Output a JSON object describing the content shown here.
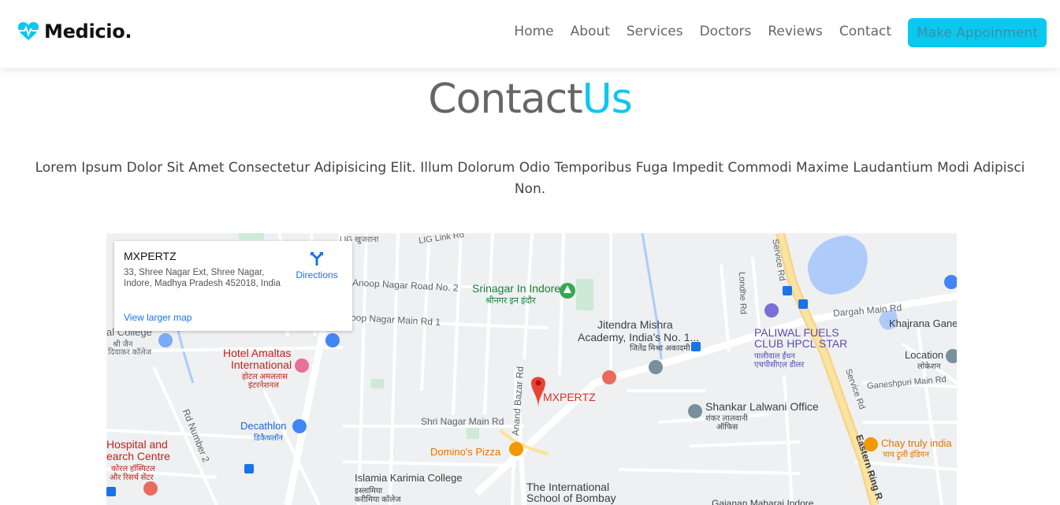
{
  "header": {
    "brand": "Medicio.",
    "nav": [
      "Home",
      "About",
      "Services",
      "Doctors",
      "Reviews",
      "Contact"
    ],
    "cta": "Make Appoinment",
    "accent_color": "#0ac8ef"
  },
  "section": {
    "title_main": "Contact",
    "title_accent": "Us",
    "description": "Lorem Ipsum Dolor Sit Amet Consectetur Adipisicing Elit. Illum Dolorum Odio Temporibus Fuga Impedit Commodi Maxime Laudantium Modi Adipisci Non."
  },
  "map": {
    "card": {
      "name": "MXPERTZ",
      "address": "33, Shree Nagar Ext, Shree Nagar, Indore, Madhya Pradesh 452018, India",
      "directions": "Directions",
      "larger_map": "View larger map"
    },
    "marker": "MXPERTZ",
    "labels": {
      "lig": "LIG खुजराना",
      "lig_link": "LIG Link Rd",
      "anoop2": "Anoop Nagar Road No. 2",
      "anoop_main": "oop Nagar Main Rd 1",
      "srinagar": "Srinagar In Indore",
      "srinagar_hi": "श्रीनगर इन इंदौर",
      "jitendra1": "Jitendra Mishra",
      "jitendra2": "Academy, India's No. 1...",
      "jitendra_hi": "जितेंद्र मिश्रा अकादमी",
      "college1": "al College",
      "college_hi1": "श्री जैन",
      "college_hi2": "दिवाकर कॉलेज",
      "hotel1": "Hotel Amaltas",
      "hotel2": "International",
      "hotel_hi1": "होटल अमलतास",
      "hotel_hi2": "इंटरनेशनल",
      "decathlon": "Decathlon",
      "decathlon_hi": "डिकैथलॉन",
      "hospital1": "Hospital and",
      "hospital2": "earch Centre",
      "hospital_hi1": "कोरल हॉस्पिटल",
      "hospital_hi2": "और रिसर्च सेंटर",
      "rd_number2": "Rd Number 2",
      "shri_nagar_main": "Shri Nagar Main Rd",
      "anand_bazar": "Anand Bazar Rd",
      "dominos": "Domino's Pizza",
      "islamia": "Islamia Karimia College",
      "islamia_hi1": "इस्लामिया",
      "islamia_hi2": "करीमिया कॉलेज",
      "intl_school1": "The International",
      "intl_school2": "School of Bombay",
      "shankar1": "Shankar Lalwani Office",
      "shankar_hi1": "शंकर लालवानी",
      "shankar_hi2": "ऑफिस",
      "paliwal1": "PALIWAL FUELS",
      "paliwal2": "CLUB HPCL STAR",
      "paliwal_hi1": "पालीवाल ईंधन",
      "paliwal_hi2": "एचपीसीएल डीलर",
      "dargah": "Dargah Main Rd",
      "khajrana": "Khajrana Gane",
      "location": "Location",
      "location_hi": "लोकेशन",
      "ganeshpuri": "Ganeshpuri Main Rd",
      "chai": "Chay truly india",
      "chai_hi": "चाय ट्रूली इंडियन",
      "service_rd": "Service Rd",
      "service_rd2": "Service Rd",
      "londhe": "Londhe Rd",
      "eastern_ring": "Eastern Ring R",
      "gajanan": "Gajanan Maharaj Indore"
    }
  }
}
